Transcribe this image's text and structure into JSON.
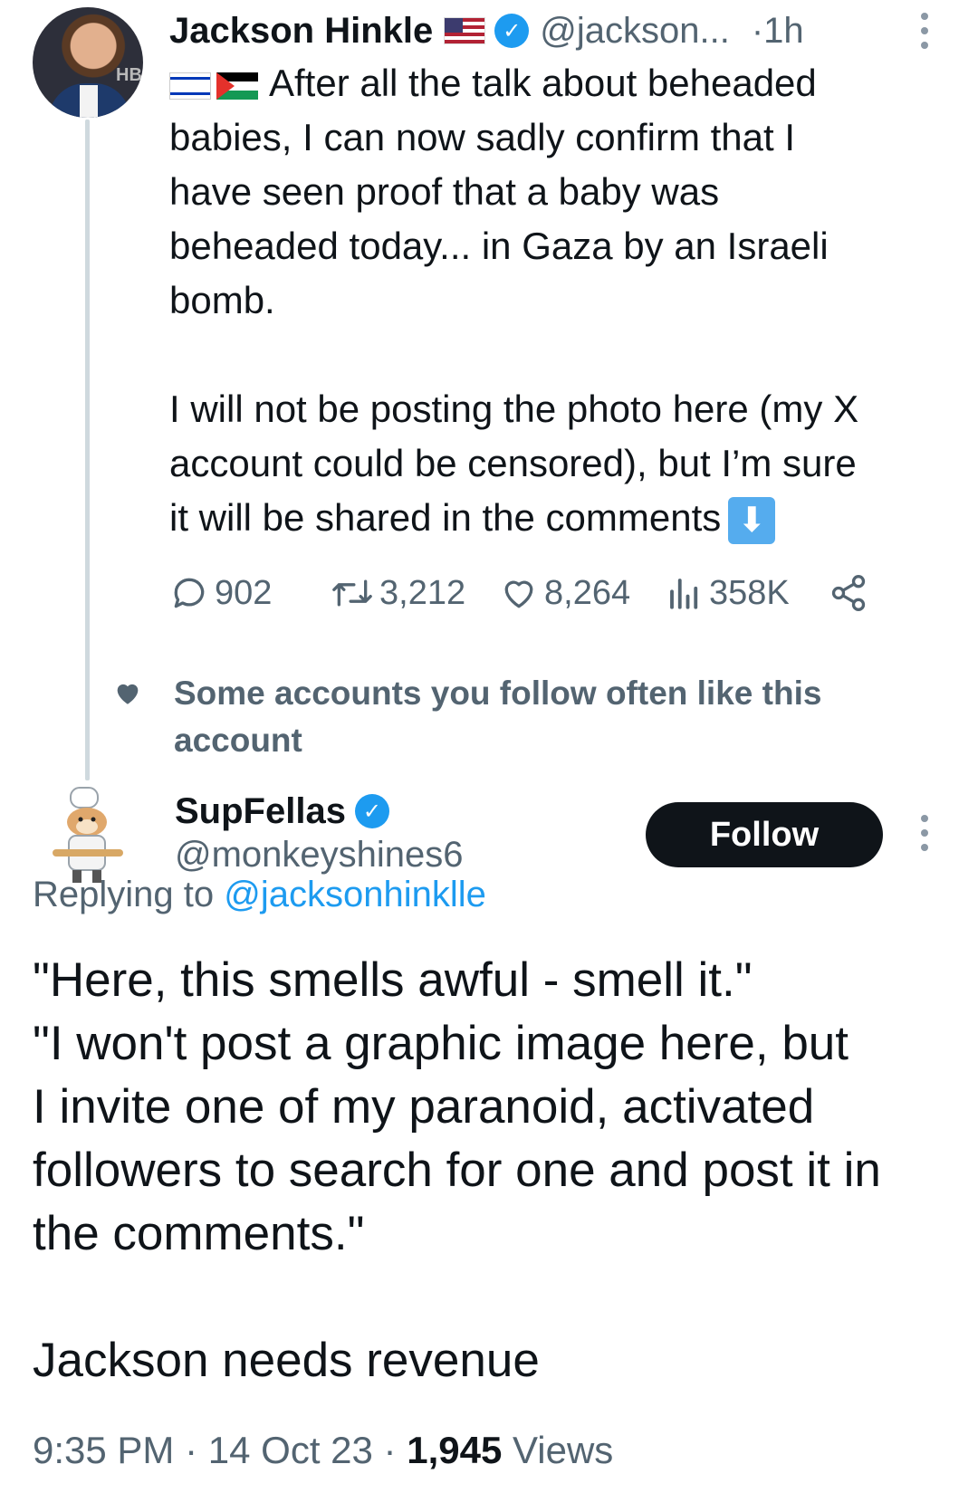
{
  "tweet": {
    "author_name": "Jackson Hinkle",
    "handle": "@jackson...",
    "time_sep": "·",
    "time": "1h",
    "avatar_text": "HB",
    "text_line1": "After all the talk about beheaded",
    "text_rest": "babies, I can now sadly confirm that I\nhave seen proof that a baby was\nbeheaded today... in Gaza by an Israeli\nbomb.\n\nI will not be posting the photo here (my X\naccount could be censored), but I’m sure\nit will be shared in the comments",
    "arrow_emoji": "⬇",
    "actions": {
      "replies": "902",
      "reposts": "3,212",
      "likes": "8,264",
      "views": "358K"
    },
    "icons": [
      "verified-badge-icon",
      "us-flag-icon",
      "israel-flag-icon",
      "palestine-flag-icon",
      "down-arrow-icon",
      "reply-icon",
      "repost-icon",
      "like-icon",
      "views-icon",
      "share-icon",
      "more-icon"
    ]
  },
  "social_context": {
    "text": "Some accounts you follow often like this account"
  },
  "reply": {
    "author_name": "SupFellas",
    "handle": "@monkeyshines6",
    "follow_label": "Follow",
    "replying_prefix": "Replying to",
    "replying_handle": "@jacksonhinklle",
    "text": "\"Here, this smells awful - smell it.\"\n\"I won't post a graphic image here, but\nI invite one of my paranoid, activated\nfollowers to search for one and post it in\nthe comments.\"",
    "text2": "Jackson needs revenue",
    "time": "9:35 PM",
    "sep1": "·",
    "date": "14 Oct 23",
    "sep2": "·",
    "views_count": "1,945",
    "views_label": "Views"
  },
  "colors": {
    "accent": "#1d9bf0",
    "text": "#0f1419",
    "muted": "#536471",
    "thread_line": "#cfd9de"
  }
}
